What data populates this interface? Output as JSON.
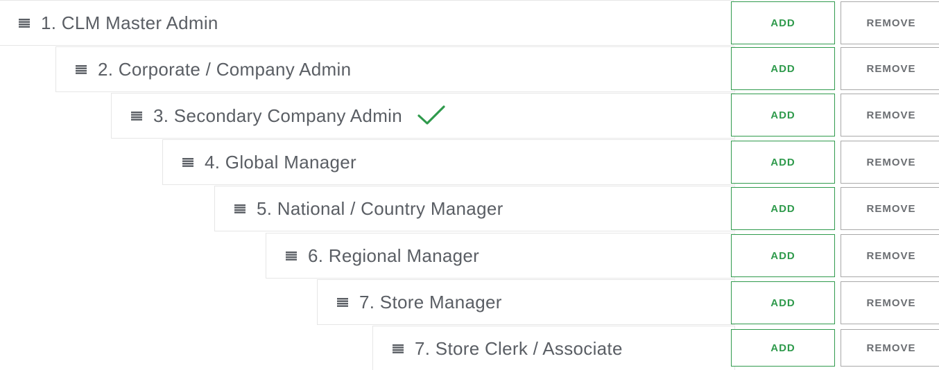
{
  "colors": {
    "accent_green": "#2f9a4c",
    "label_text": "#5a5e64",
    "remove_text": "#6b6e72",
    "row_border": "#e6e6e6"
  },
  "roles": [
    {
      "label": "1. CLM Master Admin",
      "add_label": "ADD",
      "remove_label": "REMOVE",
      "selected": false
    },
    {
      "label": "2. Corporate / Company Admin",
      "add_label": "ADD",
      "remove_label": "REMOVE",
      "selected": false
    },
    {
      "label": "3. Secondary Company Admin",
      "add_label": "ADD",
      "remove_label": "REMOVE",
      "selected": true
    },
    {
      "label": "4. Global Manager",
      "add_label": "ADD",
      "remove_label": "REMOVE",
      "selected": false
    },
    {
      "label": "5. National / Country Manager",
      "add_label": "ADD",
      "remove_label": "REMOVE",
      "selected": false
    },
    {
      "label": "6. Regional Manager",
      "add_label": "ADD",
      "remove_label": "REMOVE",
      "selected": false
    },
    {
      "label": "7. Store Manager",
      "add_label": "ADD",
      "remove_label": "REMOVE",
      "selected": false
    },
    {
      "label": "7. Store Clerk / Associate",
      "add_label": "ADD",
      "remove_label": "REMOVE",
      "selected": false
    }
  ],
  "icons": {
    "handle": "drag-handle-icon",
    "selected": "checkmark-icon"
  }
}
